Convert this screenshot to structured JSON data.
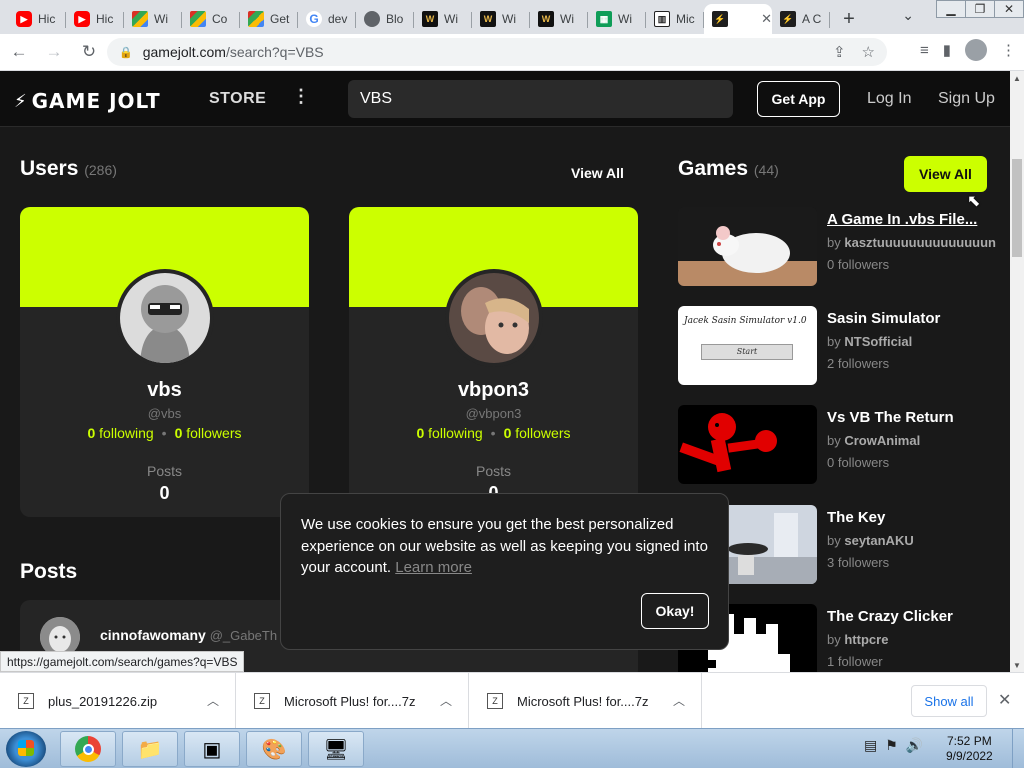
{
  "browser": {
    "tabs": [
      {
        "title": "Hic",
        "icon": "youtube-icon",
        "favtext": "▶"
      },
      {
        "title": "Hic",
        "icon": "youtube-icon",
        "favtext": "▶"
      },
      {
        "title": "Wi",
        "icon": "wikihow-icon",
        "favtext": ""
      },
      {
        "title": "Co",
        "icon": "wikihow-icon",
        "favtext": ""
      },
      {
        "title": "Get",
        "icon": "wikihow-icon",
        "favtext": ""
      },
      {
        "title": "dev",
        "icon": "google-icon",
        "favtext": "G"
      },
      {
        "title": "Blo",
        "icon": "globe-icon",
        "favtext": ""
      },
      {
        "title": "Wi",
        "icon": "wiki-w-icon",
        "favtext": "W"
      },
      {
        "title": "Wi",
        "icon": "wiki-w-icon",
        "favtext": "W"
      },
      {
        "title": "Wi",
        "icon": "wiki-w-icon",
        "favtext": "W"
      },
      {
        "title": "Wi",
        "icon": "spreadsheet-icon",
        "favtext": "▦"
      },
      {
        "title": "Mic",
        "icon": "museum-icon",
        "favtext": "▥"
      },
      {
        "title": "",
        "icon": "gamejolt-icon",
        "favtext": "⚡",
        "active": true
      },
      {
        "title": "A C",
        "icon": "gamejolt-icon",
        "favtext": "⚡"
      }
    ],
    "new_tab": "+",
    "url_host": "gamejolt.com",
    "url_path": "/search?q=VBS",
    "status_url": "https://gamejolt.com/search/games?q=VBS"
  },
  "nav": {
    "logo": "GAME JOLT",
    "store": "STORE",
    "more": "⋮",
    "search_value": "VBS",
    "get_app": "Get App",
    "login": "Log In",
    "signup": "Sign Up"
  },
  "users": {
    "title": "Users",
    "count": "(286)",
    "view_all": "View All",
    "posts_label": "Posts",
    "cards": [
      {
        "name": "vbs",
        "handle": "@vbs",
        "following": "0",
        "following_label": "following",
        "followers": "0",
        "followers_label": "followers",
        "posts": "0"
      },
      {
        "name": "vbpon3",
        "handle": "@vbpon3",
        "following": "0",
        "following_label": "following",
        "followers": "0",
        "followers_label": "followers",
        "posts": "0"
      }
    ]
  },
  "games": {
    "title": "Games",
    "count": "(44)",
    "view_all": "View All",
    "by": "by",
    "items": [
      {
        "title": "A Game In .vbs File...",
        "author": "kasztuuuuuuuuuuuuuun",
        "followers": "0 followers"
      },
      {
        "title": "Sasin Simulator",
        "author": "NTSofficial",
        "followers": "2 followers",
        "thumb_text": "Jacek Sasin Simulator v1.0",
        "thumb_button": "Start"
      },
      {
        "title": "Vs VB The Return",
        "author": "CrowAnimal",
        "followers": "0 followers"
      },
      {
        "title": "The Key",
        "author": "seytanAKU",
        "followers": "3 followers"
      },
      {
        "title": "The Crazy Clicker",
        "author": "httpcre",
        "followers": "1 follower"
      }
    ]
  },
  "posts": {
    "title": "Posts",
    "first": {
      "name": "cinnofawomany",
      "handle": "@_GabeTh"
    }
  },
  "cookie": {
    "text": "We use cookies to ensure you get the best personalized experience on our website as well as keeping you signed into your account.",
    "link": "Learn more",
    "okay": "Okay!"
  },
  "downloads": {
    "items": [
      {
        "name": "plus_20191226.zip"
      },
      {
        "name": "Microsoft Plus! for....7z"
      },
      {
        "name": "Microsoft Plus! for....7z"
      }
    ],
    "show_all": "Show all"
  },
  "taskbar": {
    "time": "7:52 PM",
    "date": "9/9/2022"
  },
  "colors": {
    "accent": "#ccff00",
    "background": "#191919",
    "card": "#252525"
  }
}
